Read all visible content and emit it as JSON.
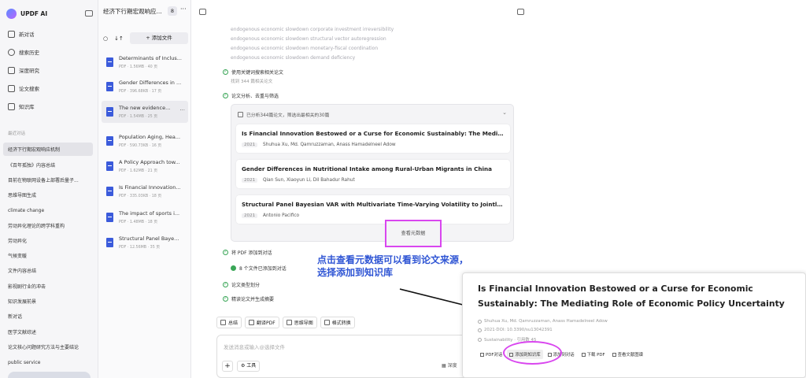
{
  "sidebar": {
    "app_name": "UPDF AI",
    "nav": [
      "新对话",
      "搜索历史",
      "深度研究",
      "论文搜索",
      "知识库"
    ],
    "recent_label": "最近对话",
    "history": [
      "经济下行期宏观响应机制",
      "《百年孤独》内容总结",
      "目前在物联网设备上部署后量子...",
      "思维导图生成",
      "climate change",
      "劳动异化理论的跨学科重构",
      "劳动异化",
      "气候变暖",
      "文件内容总结",
      "影视剧行业的冲击",
      "知识发展前景",
      "新对话",
      "医学文献综述",
      "论文核心问题研究方法与主要结论",
      "public service"
    ]
  },
  "files": {
    "title": "经济下行期宏观响应...",
    "count": "8",
    "add_label": "+ 添加文件",
    "items": [
      {
        "name": "Determinants of Inclus...",
        "meta": "PDF · 1.56MB · 40 页"
      },
      {
        "name": "Gender Differences in ...",
        "meta": "PDF · 396.68KB · 17 页"
      },
      {
        "name": "The new evidence...",
        "meta": "PDF · 1.54MB · 25 页"
      },
      {
        "name": "Population Aging, Hea...",
        "meta": "PDF · 590.73KB · 16 页"
      },
      {
        "name": "A Policy Approach tow...",
        "meta": "PDF · 1.62MB · 21 页"
      },
      {
        "name": "Is Financial Innovation...",
        "meta": "PDF · 335.03KB · 18 页"
      },
      {
        "name": "The impact of sports i...",
        "meta": "PDF · 1.48MB · 18 页"
      },
      {
        "name": "Structural Panel Bayesi...",
        "meta": "PDF · 12.56MB · 35 页"
      }
    ]
  },
  "main": {
    "keywords": [
      "endogenous economic slowdown corporate investment irreversibility",
      "endogenous economic slowdown structural vector autoregression",
      "endogenous economic slowdown monetary-fiscal coordination",
      "endogenous economic slowdown demand deficiency"
    ],
    "step1": "使用关键词搜索相关论文",
    "step1_sub": "找到 344 篇相关论文",
    "step2": "论文分析、去重与筛选",
    "box_head": "已分析344篇论文，筛选出最相关的30篇",
    "papers": [
      {
        "title": "Is Financial Innovation Bestowed or a Curse for Economic Sustainably: The Mediatin...",
        "year": "2021",
        "authors": "Shuhua Xu, Md. Qamruzzaman, Anass Hamadelneel Adow"
      },
      {
        "title": "Gender Differences in Nutritional Intake among Rural-Urban Migrants in China",
        "year": "2021",
        "authors": "Qian Sun, Xiaoyun Li, Dil Bahadur Rahut"
      },
      {
        "title": "Structural Panel Bayesian VAR with Multivariate Time-Varying Volatility to Jointly D...",
        "year": "2021",
        "authors": "Antonio Pacifico"
      }
    ],
    "meta_button": "查看元数据",
    "step3": "将 PDF 添加到对话",
    "step3_sub": "8 个文件已添加到对话",
    "step4": "论文类型划分",
    "step5": "精读论文并生成摘要",
    "actions": [
      "总结",
      "翻译PDF",
      "思维导图",
      "格式转换"
    ],
    "composer_placeholder": "发送消息或输入@选择文件",
    "tools_label": "工具",
    "deep_label": "深度"
  },
  "annotation": {
    "line1": "点击查看元数据可以看到论文来源，",
    "line2": "选择添加到知识库"
  },
  "popup": {
    "title": "Is Financial Innovation Bestowed or a Curse for Economic Sustainably: The Mediating Role of Economic Policy Uncertainty",
    "authors": "Shuhua Xu, Md. Qamruzzaman, Anass Hamadelneel Adow",
    "doi": "2021·DOI: 10.3390/su13042391",
    "journal": "Sustainability · 引用数 45",
    "actions": [
      "PDF对话",
      "添加到知识库",
      "添加到对话",
      "下载 PDF",
      "查看文献图谱"
    ]
  },
  "colors": {
    "accent": "#d946ef",
    "annotation": "#2f55d4",
    "check": "#3aa657",
    "pdf": "#3b5bdb"
  }
}
